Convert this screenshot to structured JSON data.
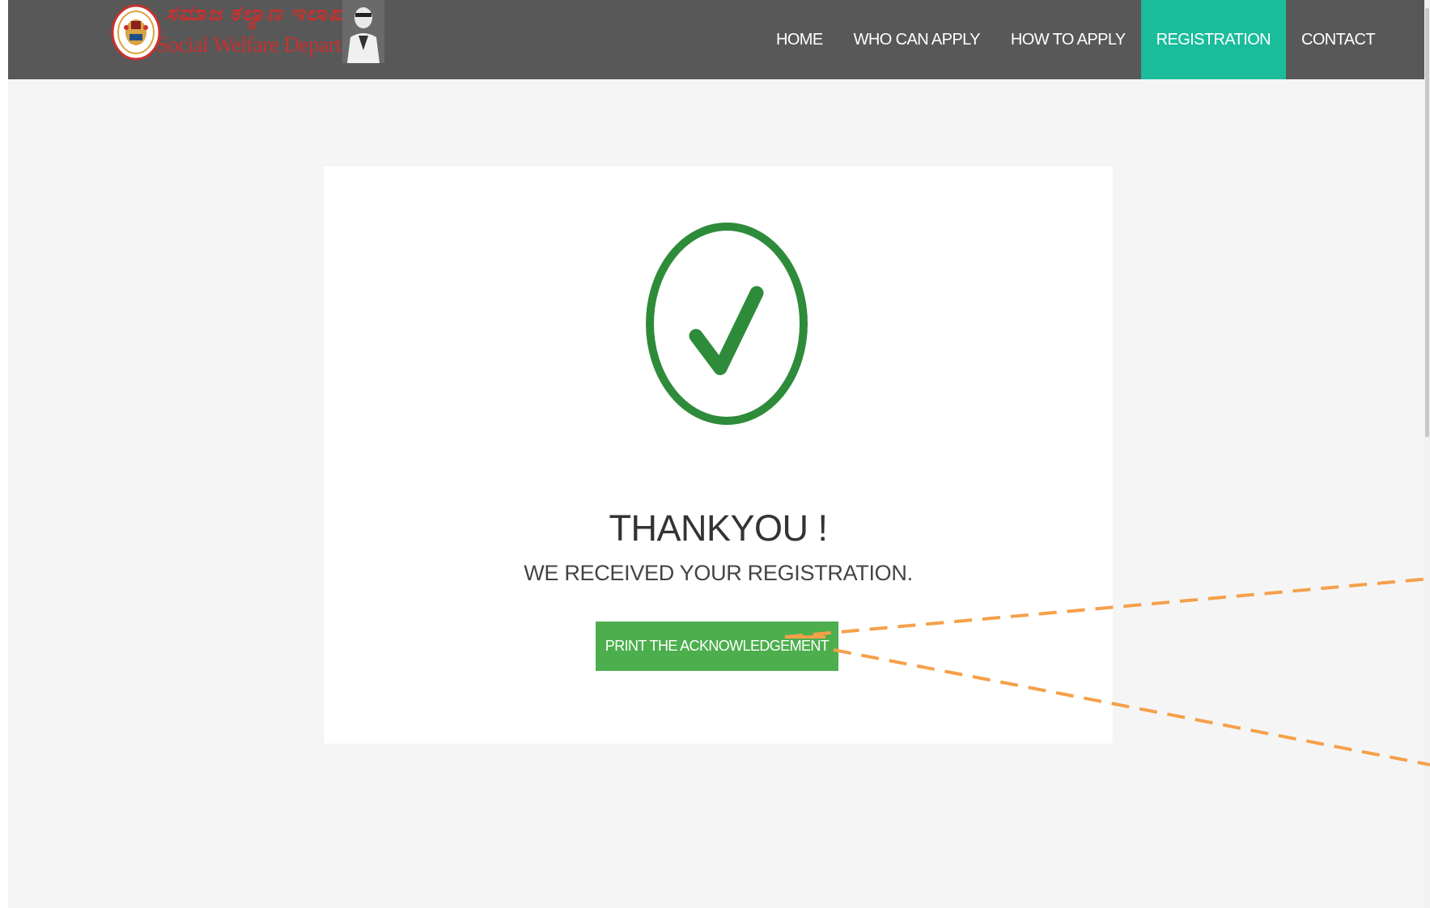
{
  "brand": {
    "kannada_title": "ಸಮಾಜ ಕಲ್ಯಾಣ ಇಲಾಖೆ",
    "english_title": "Social Welfare Department",
    "emblem_icon": "karnataka-emblem-icon",
    "portrait_icon": "portrait-icon"
  },
  "nav": {
    "items": [
      {
        "label": "HOME",
        "active": false
      },
      {
        "label": "WHO CAN APPLY",
        "active": false
      },
      {
        "label": "HOW TO APPLY",
        "active": false
      },
      {
        "label": "REGISTRATION",
        "active": true
      },
      {
        "label": "CONTACT",
        "active": false
      }
    ]
  },
  "confirmation": {
    "icon": "check-circle-icon",
    "title": "THANKYOU !",
    "subtitle": "WE RECEIVED YOUR REGISTRATION.",
    "print_button_label": "PRINT THE ACKNOWLEDGEMENT"
  },
  "colors": {
    "navbar_bg": "#585858",
    "nav_active_bg": "#1abc9c",
    "page_bg": "#f5f5f5",
    "success_green": "#2e8b3a",
    "button_green": "#4cae4c",
    "brand_red": "#c8312f",
    "annotation_orange": "#f5a04a"
  }
}
